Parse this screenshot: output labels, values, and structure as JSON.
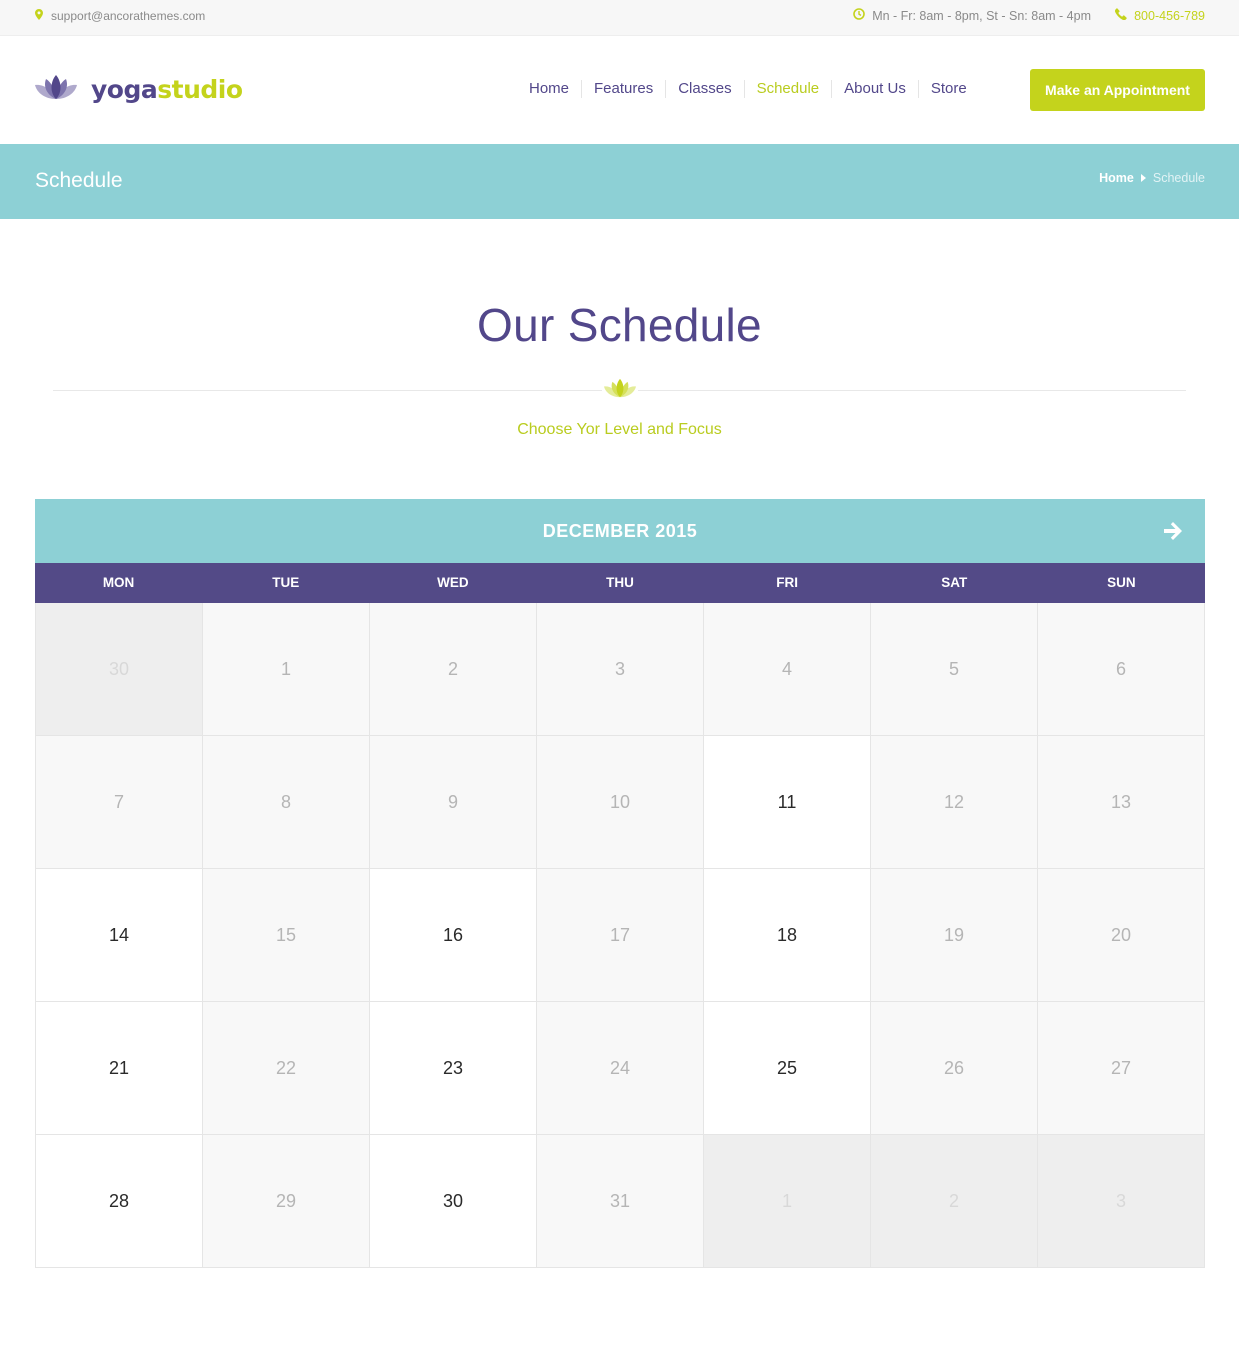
{
  "topbar": {
    "email": "support@ancorathemes.com",
    "hours": "Mn - Fr: 8am - 8pm, St - Sn: 8am - 4pm",
    "phone": "800-456-789"
  },
  "header": {
    "logo_part1": "yoga",
    "logo_part2": "studio",
    "nav": [
      "Home",
      "Features",
      "Classes",
      "Schedule",
      "About Us",
      "Store"
    ],
    "active_nav": "Schedule",
    "cta": "Make an Appointment"
  },
  "titlebar": {
    "title": "Schedule",
    "breadcrumb_home": "Home",
    "breadcrumb_current": "Schedule"
  },
  "section": {
    "heading": "Our Schedule",
    "subheading": "Choose Yor Level and Focus"
  },
  "calendar": {
    "month": "DECEMBER 2015",
    "weekdays": [
      "MON",
      "TUE",
      "WED",
      "THU",
      "FRI",
      "SAT",
      "SUN"
    ],
    "weeks": [
      [
        {
          "d": "30",
          "s": "other"
        },
        {
          "d": "1",
          "s": "muted"
        },
        {
          "d": "2",
          "s": "muted"
        },
        {
          "d": "3",
          "s": "muted"
        },
        {
          "d": "4",
          "s": "muted"
        },
        {
          "d": "5",
          "s": "muted"
        },
        {
          "d": "6",
          "s": "muted"
        }
      ],
      [
        {
          "d": "7",
          "s": "muted"
        },
        {
          "d": "8",
          "s": "muted"
        },
        {
          "d": "9",
          "s": "muted"
        },
        {
          "d": "10",
          "s": "muted"
        },
        {
          "d": "11",
          "s": "active"
        },
        {
          "d": "12",
          "s": "muted"
        },
        {
          "d": "13",
          "s": "muted"
        }
      ],
      [
        {
          "d": "14",
          "s": "active"
        },
        {
          "d": "15",
          "s": "muted"
        },
        {
          "d": "16",
          "s": "active"
        },
        {
          "d": "17",
          "s": "muted"
        },
        {
          "d": "18",
          "s": "active"
        },
        {
          "d": "19",
          "s": "muted"
        },
        {
          "d": "20",
          "s": "muted"
        }
      ],
      [
        {
          "d": "21",
          "s": "active"
        },
        {
          "d": "22",
          "s": "muted"
        },
        {
          "d": "23",
          "s": "active"
        },
        {
          "d": "24",
          "s": "muted"
        },
        {
          "d": "25",
          "s": "active"
        },
        {
          "d": "26",
          "s": "muted"
        },
        {
          "d": "27",
          "s": "muted"
        }
      ],
      [
        {
          "d": "28",
          "s": "active"
        },
        {
          "d": "29",
          "s": "muted"
        },
        {
          "d": "30",
          "s": "active"
        },
        {
          "d": "31",
          "s": "muted"
        },
        {
          "d": "1",
          "s": "other"
        },
        {
          "d": "2",
          "s": "other"
        },
        {
          "d": "3",
          "s": "other"
        }
      ]
    ]
  },
  "icons": {
    "email": "map-marker-icon",
    "hours": "clock-icon",
    "phone": "phone-icon",
    "logo": "lotus-icon",
    "divider": "lotus-icon",
    "next": "arrow-right-icon"
  },
  "colors": {
    "purple": "#52478a",
    "lime": "#c4d31c",
    "teal": "#8dd0d5"
  }
}
